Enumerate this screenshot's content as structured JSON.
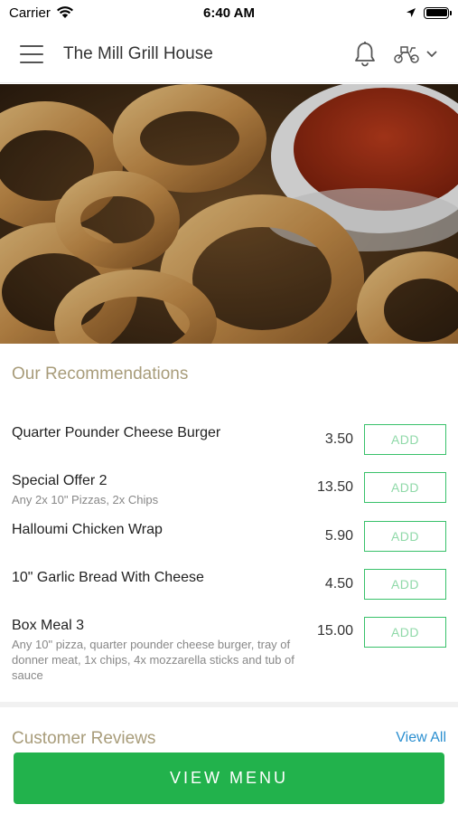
{
  "status_bar": {
    "carrier": "Carrier",
    "time": "6:40 AM"
  },
  "header": {
    "title": "The Mill Grill House",
    "icons": [
      "hamburger-menu-icon",
      "bell-icon",
      "scooter-icon",
      "chevron-down-icon"
    ]
  },
  "hero": {
    "description_icon": "onion-rings-photo"
  },
  "recommendations": {
    "title": "Our Recommendations",
    "add_label": "ADD",
    "items": [
      {
        "name": "Quarter Pounder Cheese Burger",
        "description": "",
        "price": "3.50"
      },
      {
        "name": "Special Offer 2",
        "description": "Any 2x 10\" Pizzas, 2x Chips",
        "price": "13.50"
      },
      {
        "name": "Halloumi Chicken Wrap",
        "description": "",
        "price": "5.90"
      },
      {
        "name": "10\" Garlic Bread With Cheese",
        "description": "",
        "price": "4.50"
      },
      {
        "name": "Box Meal 3",
        "description": "Any 10\" pizza, quarter pounder cheese burger, tray of donner meat, 1x chips, 4x mozzarella sticks and tub of sauce",
        "price": "15.00"
      }
    ]
  },
  "reviews": {
    "title": "Customer Reviews",
    "view_all": "View All"
  },
  "footer": {
    "view_menu": "VIEW MENU"
  },
  "colors": {
    "accent_green": "#22b24c",
    "section_title": "#a89c7a",
    "link_blue": "#2b8fd0"
  }
}
